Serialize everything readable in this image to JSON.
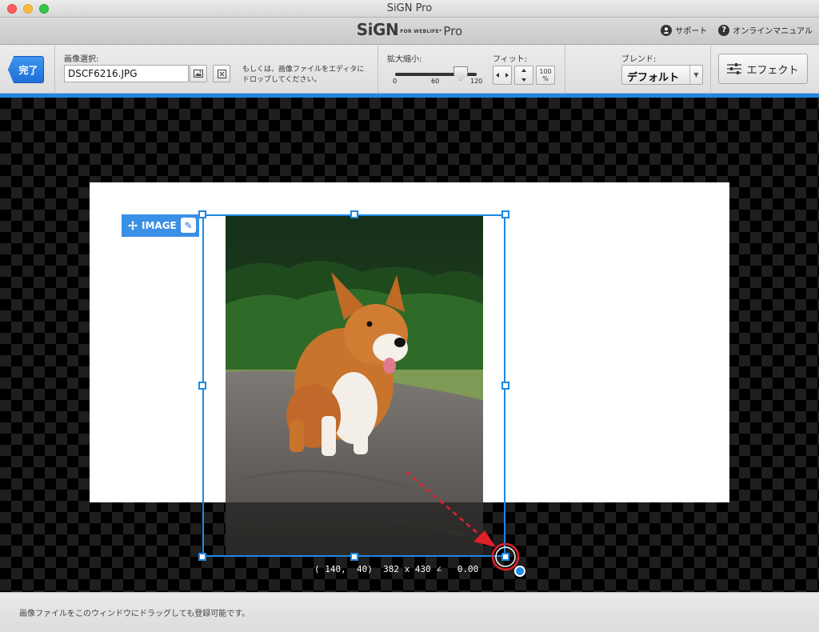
{
  "window": {
    "title": "SiGN Pro"
  },
  "brand": {
    "main": "SiGN",
    "sub": "FOR WEBLIFE*",
    "edition": "Pro"
  },
  "top_links": [
    {
      "label": "サポート",
      "icon": "user-icon"
    },
    {
      "label": "オンラインマニュアル",
      "icon": "help-icon"
    }
  ],
  "toolbar": {
    "done_label": "完了",
    "image_select_label": "画像選択:",
    "file_name": "DSCF6216.JPG",
    "hint_line1": "もしくは、画像ファイルをエディタに",
    "hint_line2": "ドロップしてください。",
    "scale_label": "拡大縮小:",
    "scale_ticks": [
      "0",
      "60",
      "120"
    ],
    "scale_value": 100,
    "scale_max": 120,
    "fit_label": "フィット:",
    "fit_100_line1": "100",
    "fit_100_line2": "%",
    "blend_label": "ブレンド:",
    "blend_value": "デフォルト",
    "effect_label": "エフェクト"
  },
  "canvas": {
    "image_tag": "IMAGE",
    "coords_text": "( 140,  40)  382 x 430 ∠   0.00"
  },
  "status": {
    "text": "画像ファイルをこのウィンドウにドラッグしても登録可能です。"
  },
  "colors": {
    "accent": "#1e88e5",
    "annotation": "#e0202a"
  }
}
